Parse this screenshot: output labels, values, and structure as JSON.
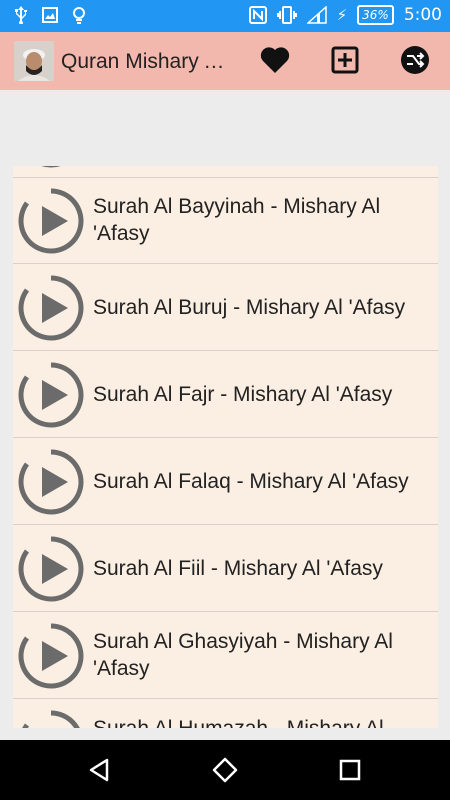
{
  "status": {
    "battery": "36%",
    "time": "5:00"
  },
  "app": {
    "title": "Quran Mishary Al 'Afasy"
  },
  "icons": {
    "usb": "usb-icon",
    "image": "image-icon",
    "bulb": "lightbulb-icon",
    "nfc": "nfc-icon",
    "vibrate": "vibrate-icon",
    "signal": "signal-icon",
    "favorite": "heart-icon",
    "add": "add-box-icon",
    "share": "share-icon",
    "back": "back-icon",
    "home": "home-icon",
    "recents": "recents-icon"
  },
  "tracks": [
    {
      "label": "Surah Al Bayyinah - Mishary Al 'Afasy"
    },
    {
      "label": "Surah Al Buruj - Mishary Al 'Afasy"
    },
    {
      "label": "Surah Al Fajr - Mishary Al 'Afasy"
    },
    {
      "label": "Surah Al Falaq - Mishary Al 'Afasy"
    },
    {
      "label": "Surah Al Fiil - Mishary Al 'Afasy"
    },
    {
      "label": "Surah Al Ghasyiyah - Mishary Al 'Afasy"
    },
    {
      "label": "Surah Al Humazah - Mishary Al 'Afasy"
    }
  ],
  "colors": {
    "status_bar": "#2196f3",
    "app_bar": "#f3b8ad",
    "list_bg": "#fbeee2",
    "icon_gray": "#6b6b6b"
  }
}
